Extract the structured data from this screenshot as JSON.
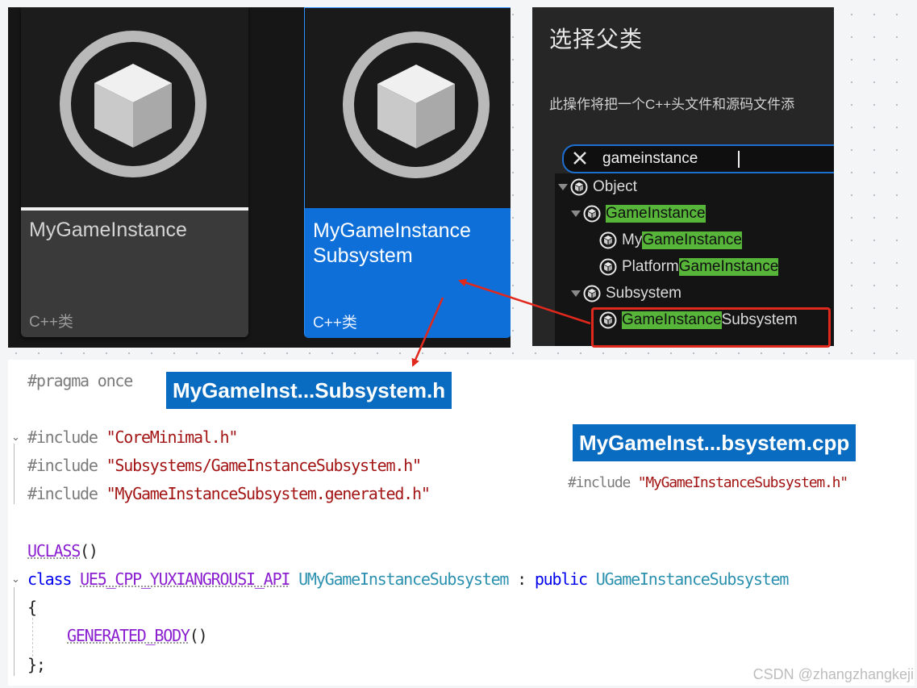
{
  "content_browser": {
    "tiles": [
      {
        "name": "MyGameInstance",
        "kind": "C++类",
        "selected": false
      },
      {
        "name_line1": "MyGameInstance",
        "name_line2": "Subsystem",
        "kind": "C++类",
        "selected": true
      }
    ]
  },
  "parent_dialog": {
    "title": "选择父类",
    "description": "此操作将把一个C++头文件和源码文件添",
    "search_value": "gameinstance",
    "tree": [
      {
        "label": "Object",
        "match": "",
        "rest": "",
        "expanded": true
      },
      {
        "label": "",
        "match": "GameInstance",
        "rest": "",
        "expanded": true
      },
      {
        "label": "My",
        "match": "GameInstance",
        "rest": ""
      },
      {
        "label": "Platform",
        "match": "GameInstance",
        "rest": ""
      },
      {
        "label": "Subsystem",
        "match": "",
        "rest": "",
        "expanded": true
      },
      {
        "label": "",
        "match": "GameInstance",
        "rest": "Subsystem",
        "selected": true
      }
    ]
  },
  "code": {
    "header_badge": "MyGameInst...Subsystem.h",
    "cpp_badge": "MyGameInst...bsystem.cpp",
    "pragma": "#pragma once",
    "includes": [
      {
        "directive": "#include",
        "file": "\"CoreMinimal.h\""
      },
      {
        "directive": "#include",
        "file": "\"Subsystems/GameInstanceSubsystem.h\""
      },
      {
        "directive": "#include",
        "file": "\"MyGameInstanceSubsystem.generated.h\""
      }
    ],
    "cpp_include": {
      "directive": "#include",
      "file": "\"MyGameInstanceSubsystem.h\""
    },
    "uclass": "UCLASS",
    "uclass_parens": "()",
    "class_kw": "class",
    "api_macro": "UE5_CPP_YUXIANGROUSI_API",
    "class_name": "UMyGameInstanceSubsystem",
    "colon": ":",
    "public_kw": "public",
    "base_class": "UGameInstanceSubsystem",
    "open_brace": "{",
    "generated_body": "GENERATED_BODY",
    "generated_parens": "()",
    "close_brace": "};"
  },
  "watermark": "CSDN @zhangzhangkeji",
  "colors": {
    "selection_blue": "#0f6fd8",
    "match_green": "#57b53a",
    "annotation_red": "#e0281c",
    "badge_blue": "#0a6cc0"
  }
}
